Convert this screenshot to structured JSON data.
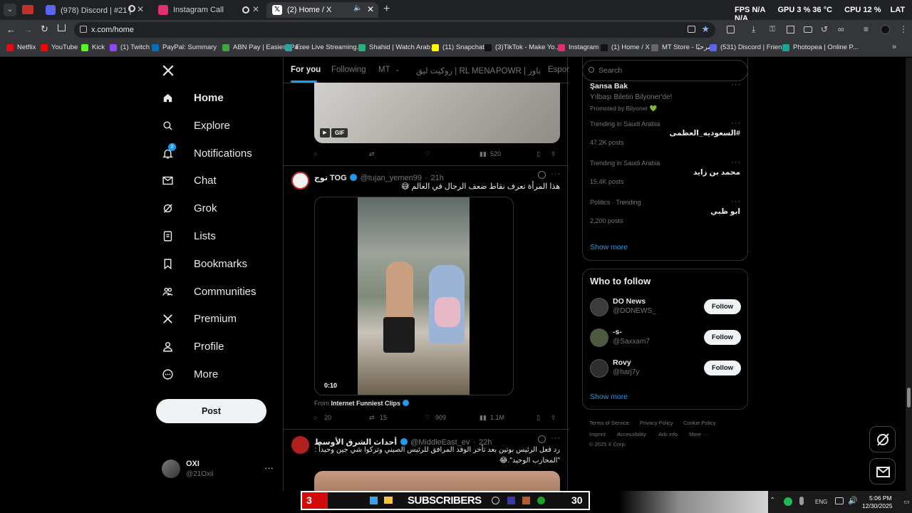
{
  "browser": {
    "tabs": [
      {
        "title": "(978) Discord | #21 | خاص ;",
        "color": "#5865f2"
      },
      {
        "title": "Instagram Call",
        "color": "#e1306c"
      },
      {
        "title": "(2) Home / X",
        "color": "#000000"
      }
    ],
    "hud": {
      "fps_label": "FPS",
      "fps_value": "N/A",
      "gpu_label": "GPU",
      "gpu_value": "3 %",
      "gpu_temp": "36 °C",
      "cpu_label": "CPU",
      "cpu_value": "12 %",
      "cpu_temp_label": "LAT",
      "cpu_temp": "N/A"
    },
    "url": "x.com/home",
    "bookmarks": [
      {
        "label": "Netflix",
        "color": "#e50914"
      },
      {
        "label": "YouTube",
        "color": "#ff0000"
      },
      {
        "label": "Kick",
        "color": "#53fc18"
      },
      {
        "label": "(1) Twitch",
        "color": "#9146ff"
      },
      {
        "label": "PayPal: Summary",
        "color": "#0070ba"
      },
      {
        "label": "ABN Pay | Easiest Pa...",
        "color": "#3ea63e"
      },
      {
        "label": "Free Live Streaming...",
        "color": "#2aa5a0"
      },
      {
        "label": "Shahid | Watch Arab...",
        "color": "#2ab07f"
      },
      {
        "label": "(11) Snapchat",
        "color": "#fffc00"
      },
      {
        "label": "(3)TikTok - Make Yo...",
        "color": "#111111"
      },
      {
        "label": "Instagram",
        "color": "#e1306c"
      },
      {
        "label": "(1) Home / X",
        "color": "#111111"
      },
      {
        "label": "MT Store - مرحبًا",
        "color": "#666666"
      },
      {
        "label": "(531) Discord | Frien...",
        "color": "#5865f2"
      },
      {
        "label": "Photopea | Online P...",
        "color": "#18a497"
      }
    ]
  },
  "nav": {
    "items": [
      {
        "label": "Home",
        "icon": "home-icon"
      },
      {
        "label": "Explore",
        "icon": "search-icon"
      },
      {
        "label": "Notifications",
        "icon": "bell-icon",
        "badge": "2"
      },
      {
        "label": "Chat",
        "icon": "mail-icon"
      },
      {
        "label": "Grok",
        "icon": "grok-icon"
      },
      {
        "label": "Lists",
        "icon": "list-icon"
      },
      {
        "label": "Bookmarks",
        "icon": "bookmark-icon"
      },
      {
        "label": "Communities",
        "icon": "people-icon"
      },
      {
        "label": "Premium",
        "icon": "x-logo-icon"
      },
      {
        "label": "Profile",
        "icon": "person-icon"
      },
      {
        "label": "More",
        "icon": "more-circle-icon"
      }
    ],
    "post_label": "Post",
    "account": {
      "name": "OXI",
      "handle": "@21Oxii"
    }
  },
  "feed": {
    "tabs": [
      "For you",
      "Following",
      "MT",
      "روكيت ليق | RL MENA",
      "POWR | باور",
      "Espor"
    ],
    "tweet1": {
      "gif_label": "GIF",
      "views": "520"
    },
    "tweet2": {
      "name": "توج TOG",
      "handle": "@tujan_yemen99",
      "time": "21h",
      "text": "هذا المرأة تعرف نقاط ضعف الرجال في العالم 😅",
      "video_time": "0:10",
      "from_label": "From",
      "from_source": "Internet Funniest Clips",
      "replies": "20",
      "reposts": "15",
      "likes": "909",
      "views": "1.1M"
    },
    "tweet3": {
      "name": "أحداث الشرق الأوسط",
      "handle": "@MiddleEast_ev",
      "time": "22h",
      "text_line1": "رد فعل الرئيس بوتين بعد تأخر الوفد المرافق للرئيس الصيني وتركوا شي جين وحيداً :",
      "text_line2": "\"المحارب الوحيد\".😂"
    }
  },
  "right": {
    "search_placeholder": "Search",
    "promo": {
      "name": "Şansa Bak",
      "tagline": "Yılbaşı Biletin Bilyoner'de!",
      "promoted": "Promoted by Bilyoner 💚"
    },
    "trends": [
      {
        "context": "Trending in Saudi Arabia",
        "topic": "#السعوديه_العظمى",
        "posts": "47.2K posts"
      },
      {
        "context": "Trending in Saudi Arabia",
        "topic": "محمد بن زايد",
        "posts": "15.4K posts"
      },
      {
        "context": "Politics · Trending",
        "topic": "ابو ظبي",
        "posts": "2,200 posts"
      }
    ],
    "show_more": "Show more",
    "who_to_follow": {
      "title": "Who to follow",
      "users": [
        {
          "name": "DO News",
          "handle": "@DONEWS_"
        },
        {
          "name": "-s-",
          "handle": "@Saxxam7"
        },
        {
          "name": "Rovy",
          "handle": "@harj7y"
        }
      ],
      "follow_label": "Follow",
      "show_more": "Show more"
    },
    "footer": {
      "links": [
        "Terms of Service",
        "Privacy Policy",
        "Cookie Policy",
        "Imprint",
        "Accessibility",
        "Ads info",
        "More ···"
      ],
      "copyright": "© 2025 X Corp."
    }
  },
  "taskbar": {
    "left_num": "3",
    "banner": "SUBSCRIBERS",
    "right_num": "30",
    "lang": "ENG",
    "time": "5:06 PM",
    "date": "12/30/2025"
  },
  "colors": {
    "accent": "#1d9bf0",
    "bg": "#000000",
    "border": "#2f3336",
    "muted": "#71767b"
  }
}
